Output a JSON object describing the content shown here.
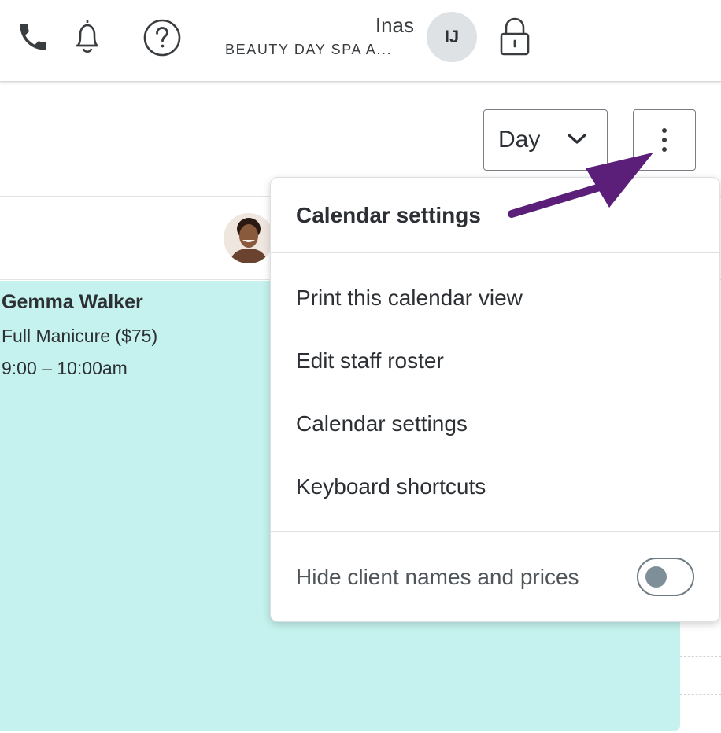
{
  "header": {
    "user_name": "Inas",
    "org_name": "BEAUTY DAY SPA A...",
    "user_initials": "IJ",
    "icons": [
      "phone-icon",
      "bell-icon",
      "help-icon",
      "lock-icon"
    ]
  },
  "toolbar": {
    "view_select_value": "Day",
    "more_icon": "more-vertical-icon"
  },
  "appointment": {
    "client_name": "Gemma Walker",
    "service": "Full Manicure ($75)",
    "time": "9:00 – 10:00am",
    "color": "#c5f2ee"
  },
  "menu": {
    "title": "Calendar settings",
    "items": [
      {
        "label": "Print this calendar view"
      },
      {
        "label": "Edit staff roster"
      },
      {
        "label": "Calendar settings"
      },
      {
        "label": "Keyboard shortcuts"
      }
    ],
    "toggle_label": "Hide client names and prices",
    "toggle_on": false
  },
  "annotation": {
    "arrow_color": "#5b1f7a"
  }
}
